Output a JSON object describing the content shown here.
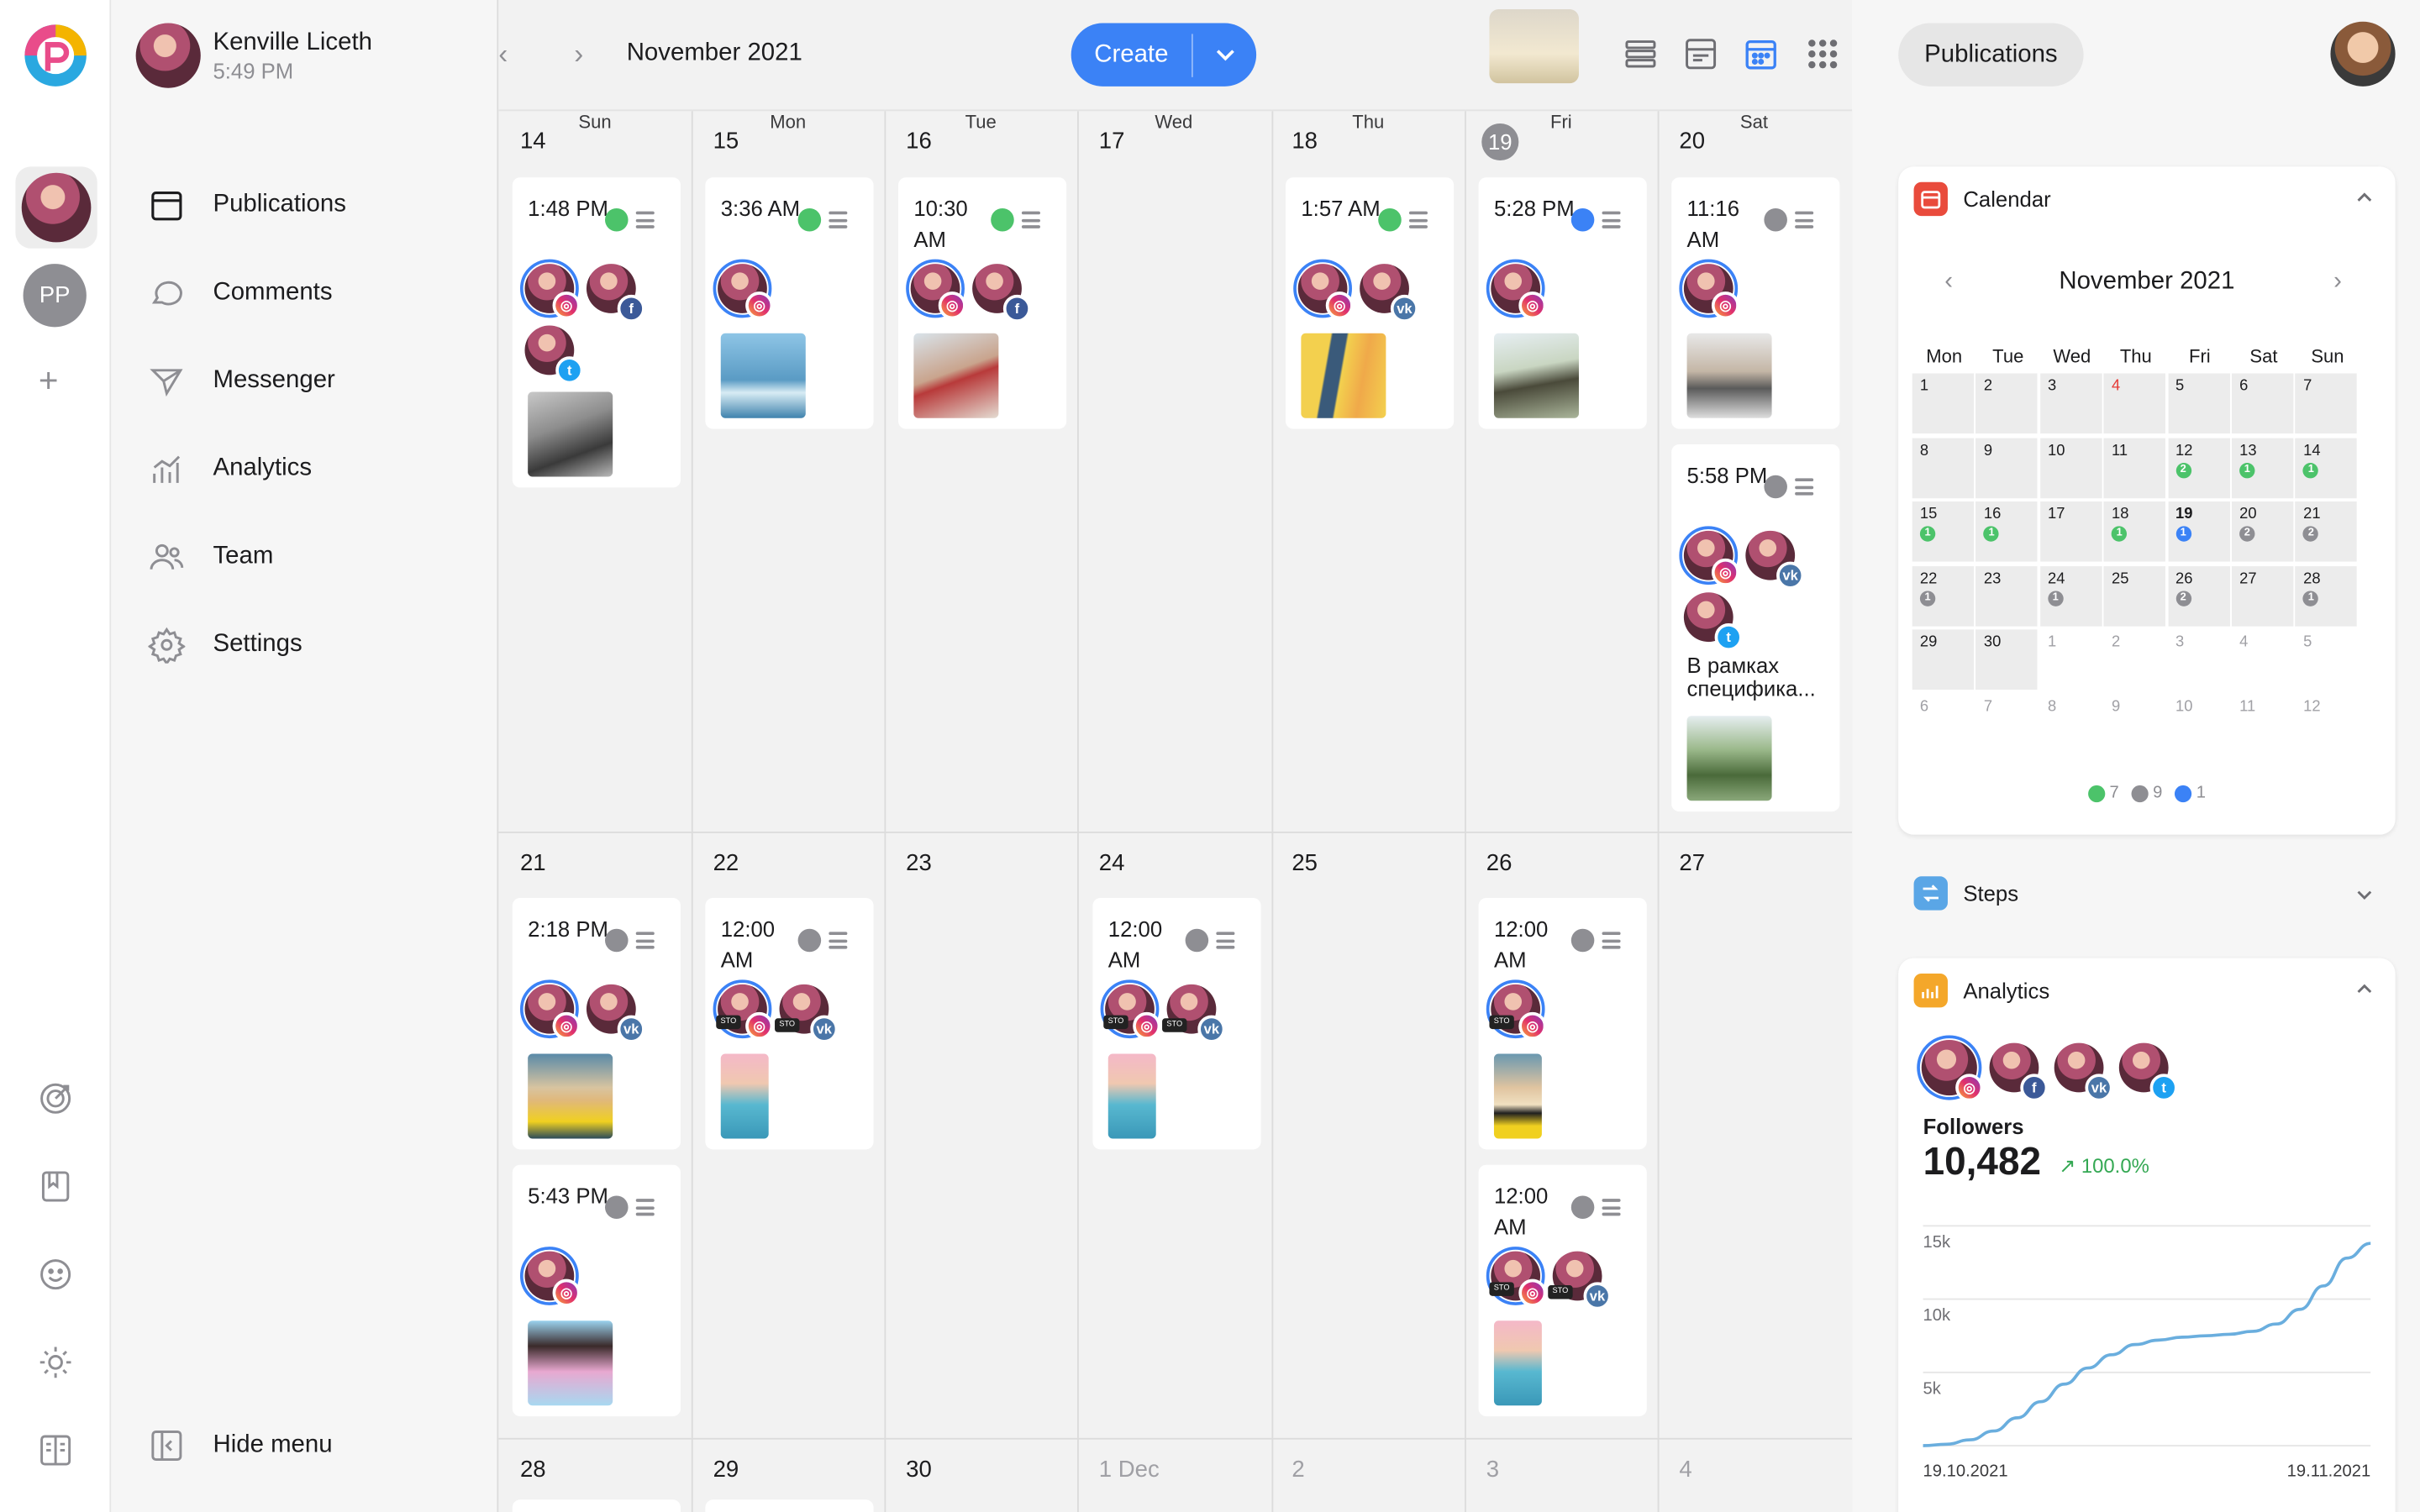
{
  "user": {
    "name": "Kenville Liceth",
    "time": "5:49 PM"
  },
  "rail": {
    "workspace_initials": "PP",
    "add": "+"
  },
  "nav": [
    {
      "label": "Publications",
      "icon": "calendar-icon"
    },
    {
      "label": "Comments",
      "icon": "comment-icon"
    },
    {
      "label": "Messenger",
      "icon": "send-icon"
    },
    {
      "label": "Analytics",
      "icon": "analytics-icon"
    },
    {
      "label": "Team",
      "icon": "team-icon"
    },
    {
      "label": "Settings",
      "icon": "gear-icon"
    }
  ],
  "hide_menu": "Hide menu",
  "calendar": {
    "month": "November 2021",
    "create_label": "Create",
    "weekdays": [
      "Sun",
      "Mon",
      "Tue",
      "Wed",
      "Thu",
      "Fri",
      "Sat"
    ],
    "weeks": [
      [
        "14",
        "15",
        "16",
        "17",
        "18",
        "19",
        "20"
      ],
      [
        "21",
        "22",
        "23",
        "24",
        "25",
        "26",
        "27"
      ],
      [
        "28",
        "29",
        "30",
        "1 Dec",
        "2",
        "3",
        "4"
      ]
    ],
    "posts": {
      "sun14": {
        "time": "1:48 PM"
      },
      "mon15": {
        "time": "3:36 AM"
      },
      "tue16": {
        "time": "10:30 AM"
      },
      "thu18": {
        "time": "1:57 AM"
      },
      "fri19": {
        "time": "5:28 PM"
      },
      "sat20a": {
        "time": "11:16 AM"
      },
      "sat20b": {
        "time": "5:58 PM",
        "text": "В рамках специфика..."
      },
      "sun21a": {
        "time": "2:18 PM"
      },
      "sun21b": {
        "time": "5:43 PM"
      },
      "mon22": {
        "time": "12:00 AM"
      },
      "wed24": {
        "time": "12:00 AM"
      },
      "fri26a": {
        "time": "12:00 AM"
      },
      "fri26b": {
        "time": "12:00 AM"
      }
    },
    "story_label": "STO"
  },
  "right": {
    "publications_btn": "Publications",
    "mini_calendar": {
      "title": "Calendar",
      "month": "November 2021",
      "weekdays": [
        "Mon",
        "Tue",
        "Wed",
        "Thu",
        "Fri",
        "Sat",
        "Sun"
      ],
      "weeks": [
        [
          "1",
          "2",
          "3",
          "4",
          "5",
          "6",
          "7"
        ],
        [
          "8",
          "9",
          "10",
          "11",
          "12",
          "13",
          "14"
        ],
        [
          "15",
          "16",
          "17",
          "18",
          "19",
          "20",
          "21"
        ],
        [
          "22",
          "23",
          "24",
          "25",
          "26",
          "27",
          "28"
        ],
        [
          "29",
          "30",
          "1",
          "2",
          "3",
          "4",
          "5"
        ],
        [
          "6",
          "7",
          "8",
          "9",
          "10",
          "11",
          "12"
        ]
      ],
      "counts": {
        "12": {
          "n": "2",
          "c": "green"
        },
        "13": {
          "n": "1",
          "c": "green"
        },
        "14": {
          "n": "1",
          "c": "green"
        },
        "15": {
          "n": "1",
          "c": "green"
        },
        "16": {
          "n": "1",
          "c": "green"
        },
        "18": {
          "n": "1",
          "c": "green"
        },
        "19": {
          "n": "1",
          "c": "blue"
        },
        "20": {
          "n": "2",
          "c": "gray"
        },
        "21": {
          "n": "2",
          "c": "gray"
        },
        "22": {
          "n": "1",
          "c": "gray"
        },
        "24": {
          "n": "1",
          "c": "gray"
        },
        "26": {
          "n": "2",
          "c": "gray"
        },
        "28": {
          "n": "1",
          "c": "gray"
        }
      },
      "legend": [
        {
          "color": "#4cc36a",
          "count": "7"
        },
        {
          "color": "#8e8e93",
          "count": "9"
        },
        {
          "color": "#3b82f6",
          "count": "1"
        }
      ]
    },
    "steps_title": "Steps",
    "analytics": {
      "title": "Analytics",
      "followers_label": "Followers",
      "followers_value": "10,482",
      "change": "↗ 100.0%"
    }
  },
  "colors": {
    "accent": "#3b82f6",
    "green": "#4cc36a",
    "gray": "#8e8e93",
    "blue": "#3b82f6"
  },
  "chart_data": {
    "type": "line",
    "x": [
      "19.10.2021",
      "19.11.2021"
    ],
    "xtick_labels": [
      "19.10.2021",
      "19.11.2021"
    ],
    "ytick_labels": [
      "15k",
      "10k",
      "5k"
    ],
    "ylim": [
      0,
      16000
    ],
    "series": [
      {
        "values": [
          0,
          100,
          400,
          1000,
          1900,
          3000,
          4200,
          5300,
          6200,
          6900,
          7200,
          7400,
          7500,
          7600,
          7800,
          8300,
          9300,
          10900,
          12800,
          13800
        ]
      }
    ]
  }
}
